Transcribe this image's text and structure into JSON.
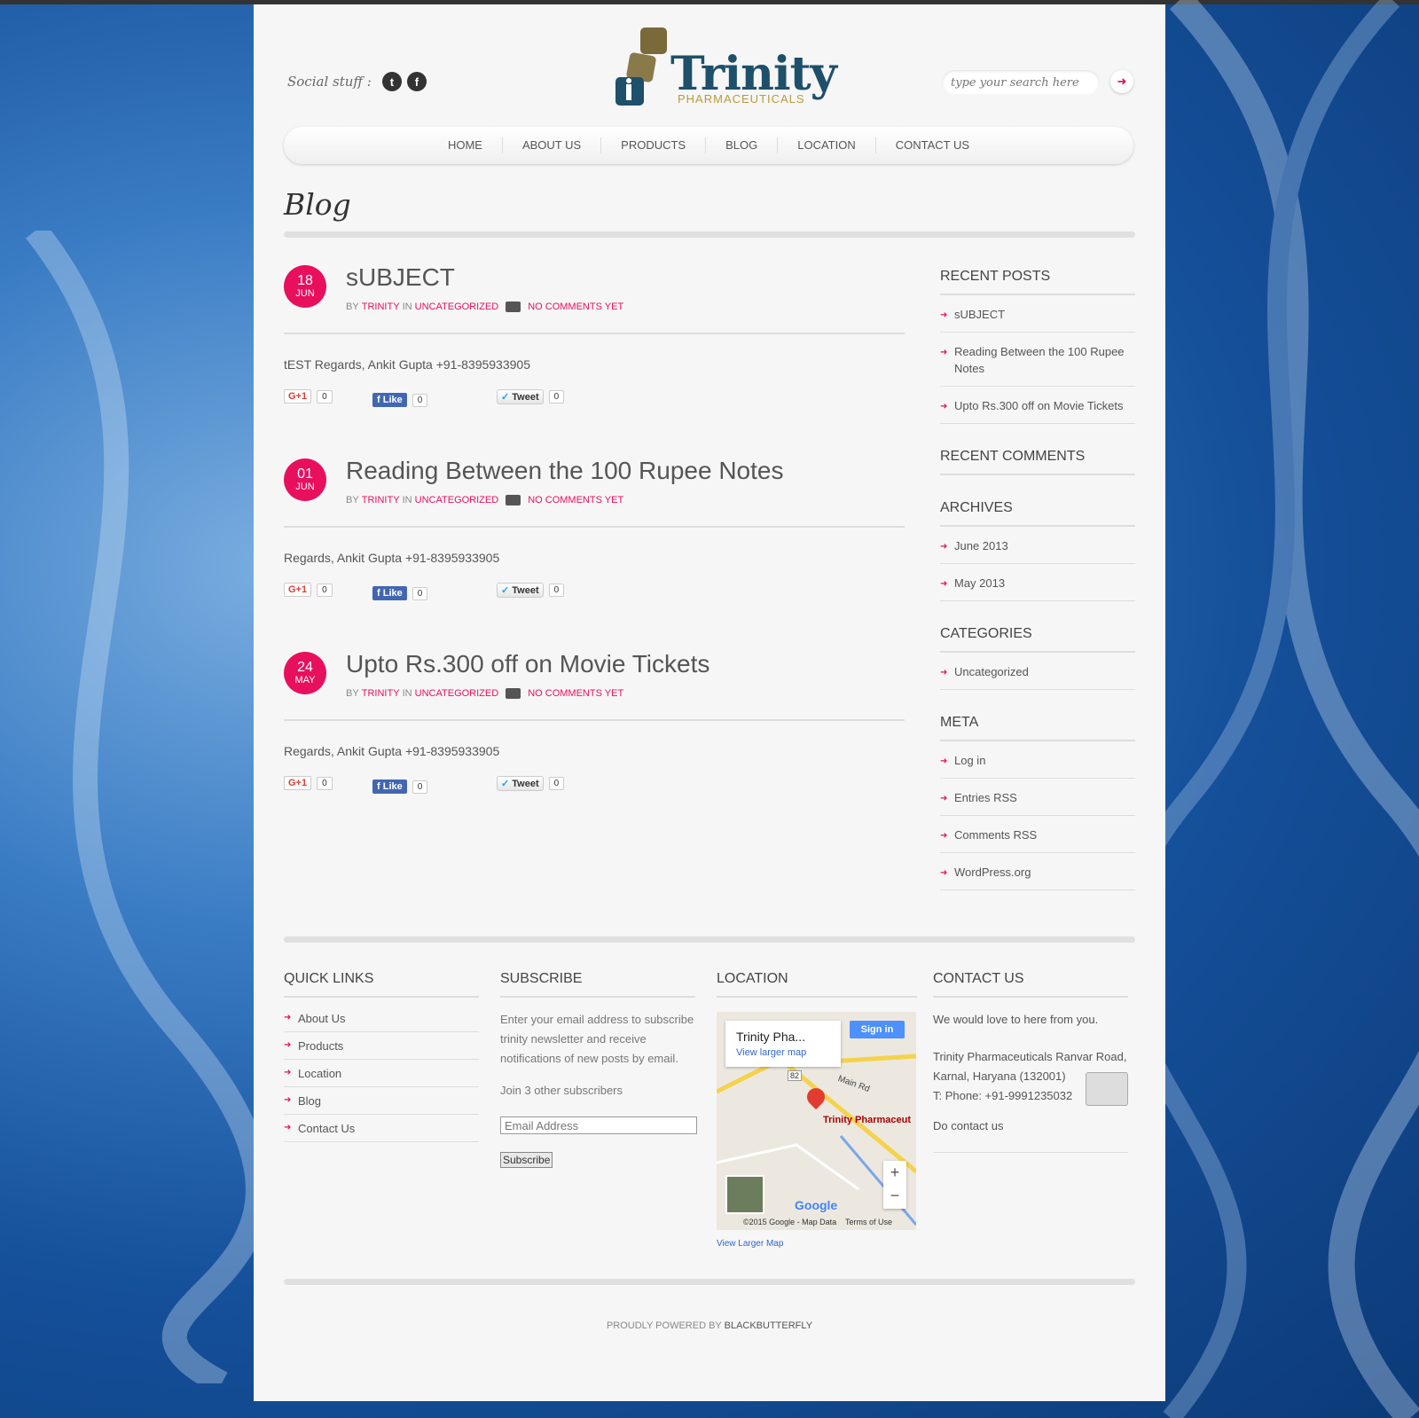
{
  "header": {
    "social_label": "Social stuff :",
    "social_icons": [
      "twitter-icon",
      "facebook-icon"
    ],
    "logo_name": "Trinity",
    "logo_sub": "PHARMACEUTICALS",
    "search_placeholder": "type your search here"
  },
  "nav": {
    "items": [
      "HOME",
      "ABOUT US",
      "PRODUCTS",
      "BLOG",
      "LOCATION",
      "CONTACT US"
    ]
  },
  "page": {
    "title": "Blog"
  },
  "posts": [
    {
      "day": "18",
      "month": "JUN",
      "title": "sUBJECT",
      "by": "BY",
      "author": "TRINITY",
      "in": "IN",
      "category": "UNCATEGORIZED",
      "comments": "NO COMMENTS YET",
      "body": "tEST Regards, Ankit Gupta +91-8395933905",
      "gplus_count": "0",
      "like_label": "Like",
      "like_count": "0",
      "tweet_label": "Tweet",
      "tweet_count": "0"
    },
    {
      "day": "01",
      "month": "JUN",
      "title": "Reading Between the 100 Rupee Notes",
      "by": "BY",
      "author": "TRINITY",
      "in": "IN",
      "category": "UNCATEGORIZED",
      "comments": "NO COMMENTS YET",
      "body": "Regards, Ankit Gupta +91-8395933905",
      "gplus_count": "0",
      "like_label": "Like",
      "like_count": "0",
      "tweet_label": "Tweet",
      "tweet_count": "0"
    },
    {
      "day": "24",
      "month": "MAY",
      "title": "Upto Rs.300 off on Movie Tickets",
      "by": "BY",
      "author": "TRINITY",
      "in": "IN",
      "category": "UNCATEGORIZED",
      "comments": "NO COMMENTS YET",
      "body": "Regards, Ankit Gupta +91-8395933905",
      "gplus_count": "0",
      "like_label": "Like",
      "like_count": "0",
      "tweet_label": "Tweet",
      "tweet_count": "0"
    }
  ],
  "sidebar": {
    "recent_posts": {
      "title": "RECENT POSTS",
      "items": [
        "sUBJECT",
        "Reading Between the 100 Rupee Notes",
        "Upto Rs.300 off on Movie Tickets"
      ]
    },
    "recent_comments": {
      "title": "RECENT COMMENTS"
    },
    "archives": {
      "title": "ARCHIVES",
      "items": [
        "June 2013",
        "May 2013"
      ]
    },
    "categories": {
      "title": "CATEGORIES",
      "items": [
        "Uncategorized"
      ]
    },
    "meta": {
      "title": "META",
      "items": [
        "Log in",
        "Entries RSS",
        "Comments RSS",
        "WordPress.org"
      ]
    }
  },
  "footer": {
    "quick_links": {
      "title": "QUICK LINKS",
      "items": [
        "About Us",
        "Products",
        "Location",
        "Blog",
        "Contact Us"
      ]
    },
    "subscribe": {
      "title": "SUBSCRIBE",
      "text": "Enter your email address to subscribe trinity newsletter and receive notifications of new posts by email.",
      "join": "Join 3 other subscribers",
      "email_placeholder": "Email Address",
      "button": "Subscribe"
    },
    "location": {
      "title": "LOCATION",
      "card_title": "Trinity Pha...",
      "card_link": "View larger map",
      "signin": "Sign in",
      "road": "Main Rd",
      "route": "82",
      "marker_label": "Trinity Pharmaceut",
      "google": "Google",
      "copyright": "©2015 Google - Map Data",
      "terms": "Terms of Use",
      "view_larger": "View Larger Map"
    },
    "contact": {
      "title": "CONTACT US",
      "intro": "We would love to here from you.",
      "address1": "Trinity Pharmaceuticals Ranvar Road,",
      "address2": "Karnal, Haryana (132001)",
      "phone": "T: Phone: +91-9991235032",
      "cta": "Do contact us"
    }
  },
  "credits": {
    "prefix": "PROUDLY POWERED BY",
    "brand": "BLACKBUTTERFLY"
  },
  "colors": {
    "accent": "#e8105e",
    "logo": "#1e4f6b",
    "logo_sub": "#b89a3a",
    "background": "#15509a"
  }
}
